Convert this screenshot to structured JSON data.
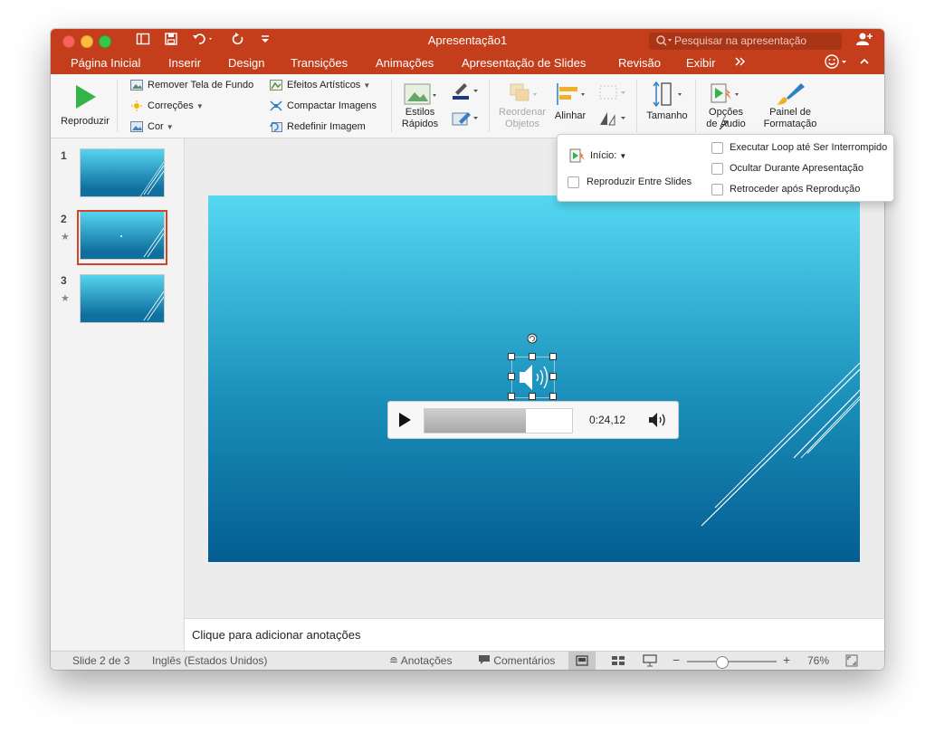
{
  "window": {
    "title": "Apresentação1"
  },
  "search": {
    "placeholder": "Pesquisar na apresentação"
  },
  "tabs": [
    "Página Inicial",
    "Inserir",
    "Design",
    "Transições",
    "Animações",
    "Apresentação de Slides",
    "Revisão",
    "Exibir"
  ],
  "ribbon": {
    "play": "Reproduzir",
    "remove_background": "Remover Tela de Fundo",
    "corrections": "Correções",
    "color": "Cor",
    "artistic_effects": "Efeitos Artísticos",
    "compress": "Compactar Imagens",
    "reset_image": "Redefinir Imagem",
    "quick_styles_1": "Estilos",
    "quick_styles_2": "Rápidos",
    "reorder_1": "Reordenar",
    "reorder_2": "Objetos",
    "align": "Alinhar",
    "size": "Tamanho",
    "audio_options_1": "Opções",
    "audio_options_2": "de Áudio",
    "format_pane_1": "Painel de",
    "format_pane_2": "Formatação"
  },
  "audio_popup": {
    "start_label": "Início:",
    "play_across": "Reproduzir Entre Slides",
    "loop": "Executar Loop até Ser Interrompido",
    "hide": "Ocultar Durante Apresentação",
    "rewind": "Retroceder após Reprodução"
  },
  "thumbnails": [
    {
      "number": "1",
      "animated": false
    },
    {
      "number": "2",
      "animated": true,
      "selected": true
    },
    {
      "number": "3",
      "animated": true
    }
  ],
  "player": {
    "time": "0:24,12",
    "progress_fraction": 0.69
  },
  "notes": {
    "placeholder": "Clique para adicionar anotações"
  },
  "status": {
    "slide": "Slide 2 de 3",
    "language": "Inglês (Estados Unidos)",
    "notes": "Anotações",
    "comments": "Comentários",
    "zoom": "76%",
    "zoom_fraction": 0.38
  },
  "colors": {
    "accent": "#c43e1c",
    "play_green": "#35b34a",
    "selection": "#d04527"
  }
}
